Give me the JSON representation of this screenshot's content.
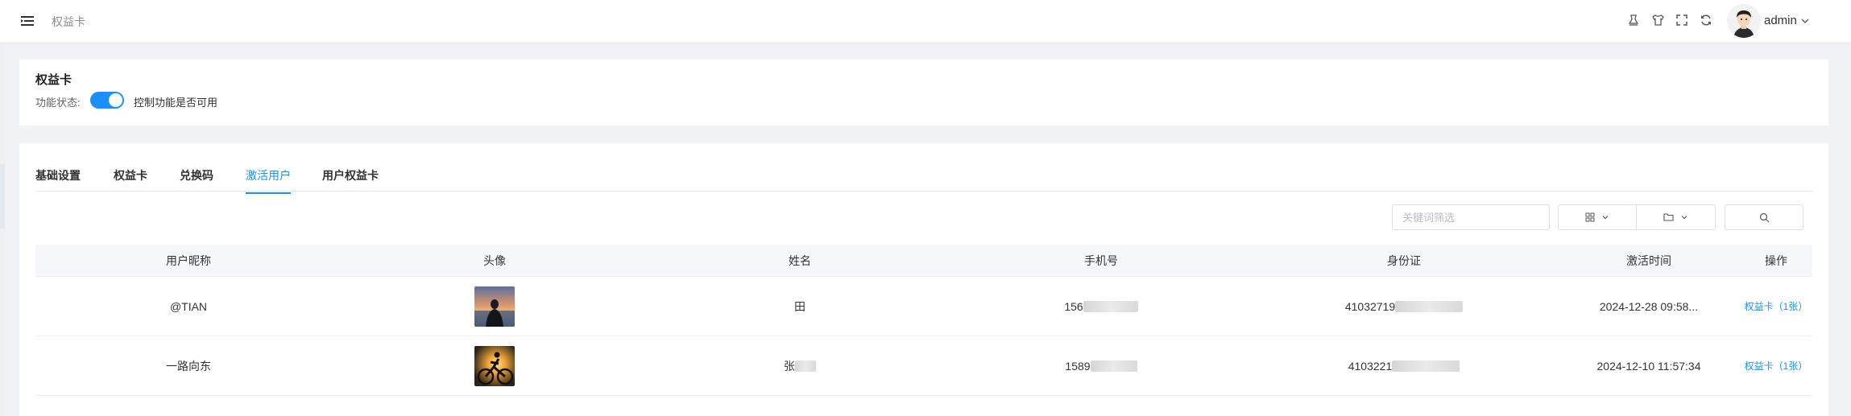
{
  "header": {
    "breadcrumb": "权益卡",
    "user_name": "admin",
    "icons": [
      "menu-fold-icon",
      "clear-icon",
      "shirt-icon",
      "fullscreen-icon",
      "refresh-icon",
      "chevron-down-icon"
    ]
  },
  "status_card": {
    "title": "权益卡",
    "label": "功能状态:",
    "switch_on": true,
    "description": "控制功能是否可用"
  },
  "tabs": [
    {
      "label": "基础设置",
      "active": false
    },
    {
      "label": "权益卡",
      "active": false
    },
    {
      "label": "兑换码",
      "active": false
    },
    {
      "label": "激活用户",
      "active": true
    },
    {
      "label": "用户权益卡",
      "active": false
    }
  ],
  "toolbar": {
    "search_placeholder": "关键词筛选",
    "icons": [
      "grid-icon",
      "folder-icon",
      "search-icon"
    ]
  },
  "table": {
    "columns": [
      "用户昵称",
      "头像",
      "姓名",
      "手机号",
      "身份证",
      "激活时间",
      "操作"
    ],
    "rows": [
      {
        "nickname": "@TIAN",
        "name": "田",
        "phone_visible": "156",
        "id_visible": "41032719",
        "activated": "2024-12-28 09:58...",
        "action": "权益卡（1张）"
      },
      {
        "nickname": "一路向东",
        "name": "张",
        "phone_visible": "1589",
        "id_visible": "4103221",
        "activated": "2024-12-10 11:57:34",
        "action": "权益卡（1张）"
      }
    ]
  },
  "colors": {
    "primary": "#1890ff",
    "header_bg": "#f5f7fa",
    "page_bg": "#f0f2f5"
  }
}
